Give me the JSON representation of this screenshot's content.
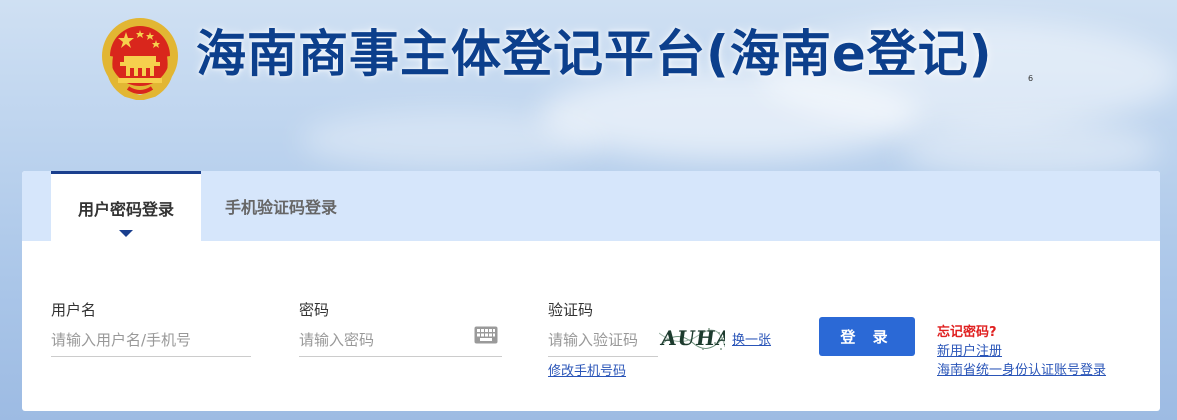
{
  "header": {
    "title": "海南商事主体登记平台(海南e登记)",
    "title_sup": "6"
  },
  "tabs": [
    {
      "label": "用户密码登录",
      "active": true
    },
    {
      "label": "手机验证码登录",
      "active": false
    }
  ],
  "form": {
    "username": {
      "label": "用户名",
      "placeholder": "请输入用户名/手机号",
      "value": ""
    },
    "password": {
      "label": "密码",
      "placeholder": "请输入密码",
      "value": ""
    },
    "captcha": {
      "label": "验证码",
      "placeholder": "请输入验证码",
      "value": "",
      "image_text": "AUHA",
      "refresh_label": "换一张"
    },
    "change_phone_link": "修改手机号码"
  },
  "login_button": "登 录",
  "side_links": {
    "forgot_password": "忘记密码?",
    "register": "新用户注册",
    "unified_login": "海南省统一身份认证账号登录"
  },
  "colors": {
    "title": "#0c3f8c",
    "accent": "#2b69d6",
    "tab_border": "#1a3f8e",
    "link": "#2a55b8",
    "forgot": "#e02020"
  },
  "icons": [
    "national-emblem-icon",
    "keyboard-icon",
    "caret-down-icon"
  ]
}
